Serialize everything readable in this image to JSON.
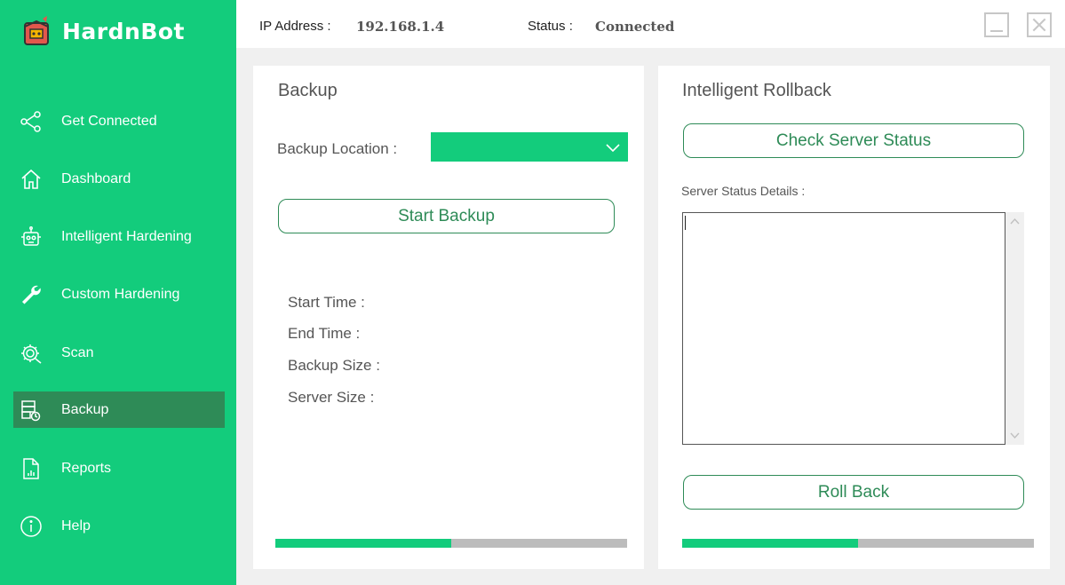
{
  "app": {
    "name": "HardnBot",
    "accent": "#13cc7c",
    "active_bg": "#2e8b57"
  },
  "sidebar": {
    "items": [
      {
        "label": "Get Connected",
        "icon": "share-nodes-icon"
      },
      {
        "label": "Dashboard",
        "icon": "home-icon"
      },
      {
        "label": "Intelligent Hardening",
        "icon": "robot-icon"
      },
      {
        "label": "Custom Hardening",
        "icon": "wrench-icon"
      },
      {
        "label": "Scan",
        "icon": "gear-scan-icon"
      },
      {
        "label": "Backup",
        "icon": "backup-icon",
        "active": true
      },
      {
        "label": "Reports",
        "icon": "report-icon"
      },
      {
        "label": "Help",
        "icon": "info-icon"
      }
    ]
  },
  "topbar": {
    "ip_label": "IP Address :",
    "ip_value": "192.168.1.4",
    "status_label": "Status :",
    "status_value": "Connected",
    "minimize_icon": "minimize-icon",
    "close_icon": "close-icon"
  },
  "backup": {
    "title": "Backup",
    "location_label": "Backup Location :",
    "location_value": "",
    "start_button": "Start Backup",
    "start_time_label": "Start Time :",
    "end_time_label": "End Time :",
    "backup_size_label": "Backup Size :",
    "server_size_label": "Server Size :",
    "progress": 0.5
  },
  "rollback": {
    "title": "Intelligent Rollback",
    "check_button": "Check Server Status",
    "details_label": "Server Status Details :",
    "details_value": "",
    "rollback_button": "Roll Back",
    "progress": 0.5
  }
}
